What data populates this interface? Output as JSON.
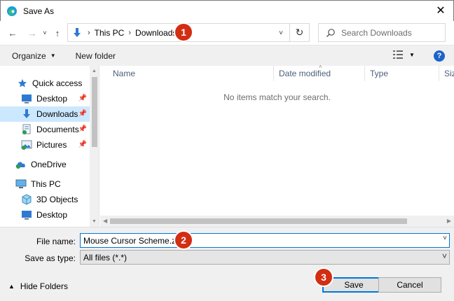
{
  "window": {
    "title": "Save As",
    "close_glyph": "✕",
    "app_icon": "edge-icon"
  },
  "navigation": {
    "back_glyph": "←",
    "forward_glyph": "→",
    "recent_glyph": "˅",
    "up_glyph": "↑",
    "breadcrumb": [
      "This PC",
      "Downloads"
    ],
    "refresh_glyph": "↻",
    "search_placeholder": "Search Downloads"
  },
  "toolbar": {
    "organize_label": "Organize",
    "new_folder_label": "New folder",
    "help_label": "?"
  },
  "sidebar": {
    "items": [
      {
        "label": "Quick access",
        "icon": "star-icon",
        "pinned": false
      },
      {
        "label": "Desktop",
        "icon": "desktop-icon",
        "pinned": true
      },
      {
        "label": "Downloads",
        "icon": "downloads-icon",
        "pinned": true,
        "selected": true
      },
      {
        "label": "Documents",
        "icon": "documents-icon",
        "pinned": true
      },
      {
        "label": "Pictures",
        "icon": "pictures-icon",
        "pinned": true
      },
      {
        "label": "OneDrive",
        "icon": "onedrive-icon",
        "pinned": false
      },
      {
        "label": "This PC",
        "icon": "this-pc-icon",
        "pinned": false
      },
      {
        "label": "3D Objects",
        "icon": "3d-objects-icon",
        "pinned": false
      },
      {
        "label": "Desktop",
        "icon": "desktop-icon",
        "pinned": false
      }
    ]
  },
  "file_list": {
    "columns": [
      "Name",
      "Date modified",
      "Type",
      "Siz"
    ],
    "empty_message": "No items match your search."
  },
  "form": {
    "filename_label": "File name:",
    "filename_value": "Mouse Cursor Scheme.zip",
    "filetype_label": "Save as type:",
    "filetype_value": "All files (*.*)"
  },
  "footer": {
    "hide_folders_label": "Hide Folders",
    "save_label": "Save",
    "cancel_label": "Cancel"
  },
  "markers": [
    "1",
    "2",
    "3"
  ],
  "colors": {
    "accent": "#0078d7",
    "selection": "#cce8ff",
    "marker": "#d32d12"
  }
}
